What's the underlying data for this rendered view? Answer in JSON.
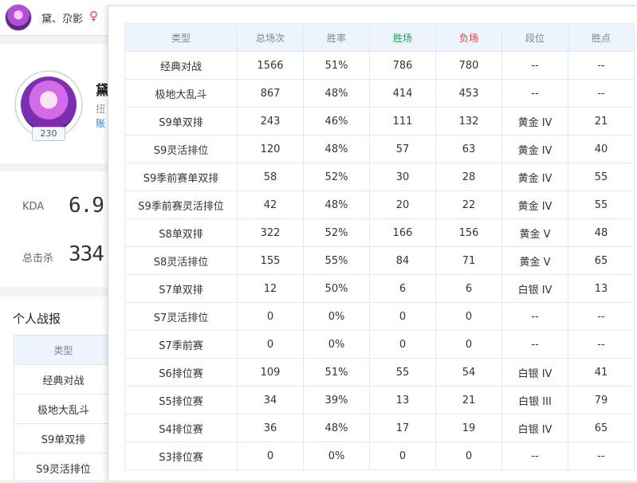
{
  "header": {
    "username": "黛、尕影",
    "gender_symbol": "♀",
    "colors": {
      "female": "#e0338c",
      "accent": "#3a7bd5"
    }
  },
  "profile": {
    "name_partial": "黛",
    "sub_partial": "扭",
    "account_partial": "账",
    "level": "230"
  },
  "stats": {
    "kda_label": "KDA",
    "kda_value": "6.9",
    "kills_label": "总击杀",
    "kills_value": "334"
  },
  "report": {
    "title": "个人战报",
    "header": "类型",
    "rows": [
      "经典对战",
      "极地大乱斗",
      "S9单双排",
      "S9灵活排位"
    ]
  },
  "table": {
    "columns": [
      "类型",
      "总场次",
      "胜率",
      "胜场",
      "负场",
      "段位",
      "胜点"
    ],
    "colors": {
      "win": "#1f9a57",
      "lose": "#e43a3a"
    },
    "rows": [
      [
        "经典对战",
        "1566",
        "51%",
        "786",
        "780",
        "--",
        "--"
      ],
      [
        "极地大乱斗",
        "867",
        "48%",
        "414",
        "453",
        "--",
        "--"
      ],
      [
        "S9单双排",
        "243",
        "46%",
        "111",
        "132",
        "黄金 IV",
        "21"
      ],
      [
        "S9灵活排位",
        "120",
        "48%",
        "57",
        "63",
        "黄金 IV",
        "40"
      ],
      [
        "S9季前赛单双排",
        "58",
        "52%",
        "30",
        "28",
        "黄金 IV",
        "55"
      ],
      [
        "S9季前赛灵活排位",
        "42",
        "48%",
        "20",
        "22",
        "黄金 IV",
        "55"
      ],
      [
        "S8单双排",
        "322",
        "52%",
        "166",
        "156",
        "黄金 V",
        "48"
      ],
      [
        "S8灵活排位",
        "155",
        "55%",
        "84",
        "71",
        "黄金 V",
        "65"
      ],
      [
        "S7单双排",
        "12",
        "50%",
        "6",
        "6",
        "白银 IV",
        "13"
      ],
      [
        "S7灵活排位",
        "0",
        "0%",
        "0",
        "0",
        "--",
        "--"
      ],
      [
        "S7季前赛",
        "0",
        "0%",
        "0",
        "0",
        "--",
        "--"
      ],
      [
        "S6排位赛",
        "109",
        "51%",
        "55",
        "54",
        "白银 IV",
        "41"
      ],
      [
        "S5排位赛",
        "34",
        "39%",
        "13",
        "21",
        "白银 III",
        "79"
      ],
      [
        "S4排位赛",
        "36",
        "48%",
        "17",
        "19",
        "白银 IV",
        "65"
      ],
      [
        "S3排位赛",
        "0",
        "0%",
        "0",
        "0",
        "--",
        "--"
      ]
    ]
  }
}
